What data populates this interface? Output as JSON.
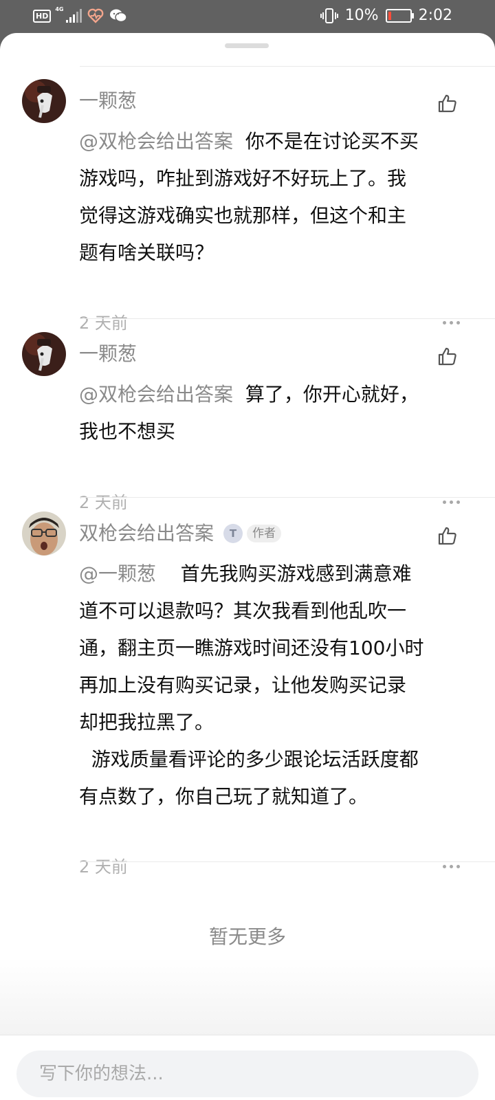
{
  "status_bar": {
    "hd": "HD",
    "network": "4G",
    "battery_percent": "10%",
    "time": "2:02"
  },
  "comments": [
    {
      "username": "一颗葱",
      "mention": "@双枪会给出答案",
      "lines": [
        "你不是在讨论买不买",
        "游戏吗，咋扯到游戏好不好玩上了。我",
        "觉得这游戏确实也就那样，但这个和主",
        "题有啥关联吗？"
      ],
      "time": "2 天前"
    },
    {
      "username": "一颗葱",
      "mention": "@双枪会给出答案",
      "lines": [
        "算了，你开心就好，",
        "我也不想买"
      ],
      "time": "2 天前"
    },
    {
      "username": "双枪会给出答案",
      "badge_letter": "T",
      "author_badge": "作者",
      "mention": "@一颗葱",
      "lines": [
        "首先我购买游戏感到满意难",
        "道不可以退款吗？其次我看到他乱吹一",
        "通，翻主页一瞧游戏时间还没有100小时",
        "再加上没有购买记录，让他发购买记录",
        "却把我拉黑了。",
        "  游戏质量看评论的多少跟论坛活跃度都",
        "有点数了，你自己玩了就知道了。"
      ],
      "time": "2 天前"
    }
  ],
  "no_more_text": "暂无更多",
  "input": {
    "placeholder": "写下你的想法..."
  }
}
